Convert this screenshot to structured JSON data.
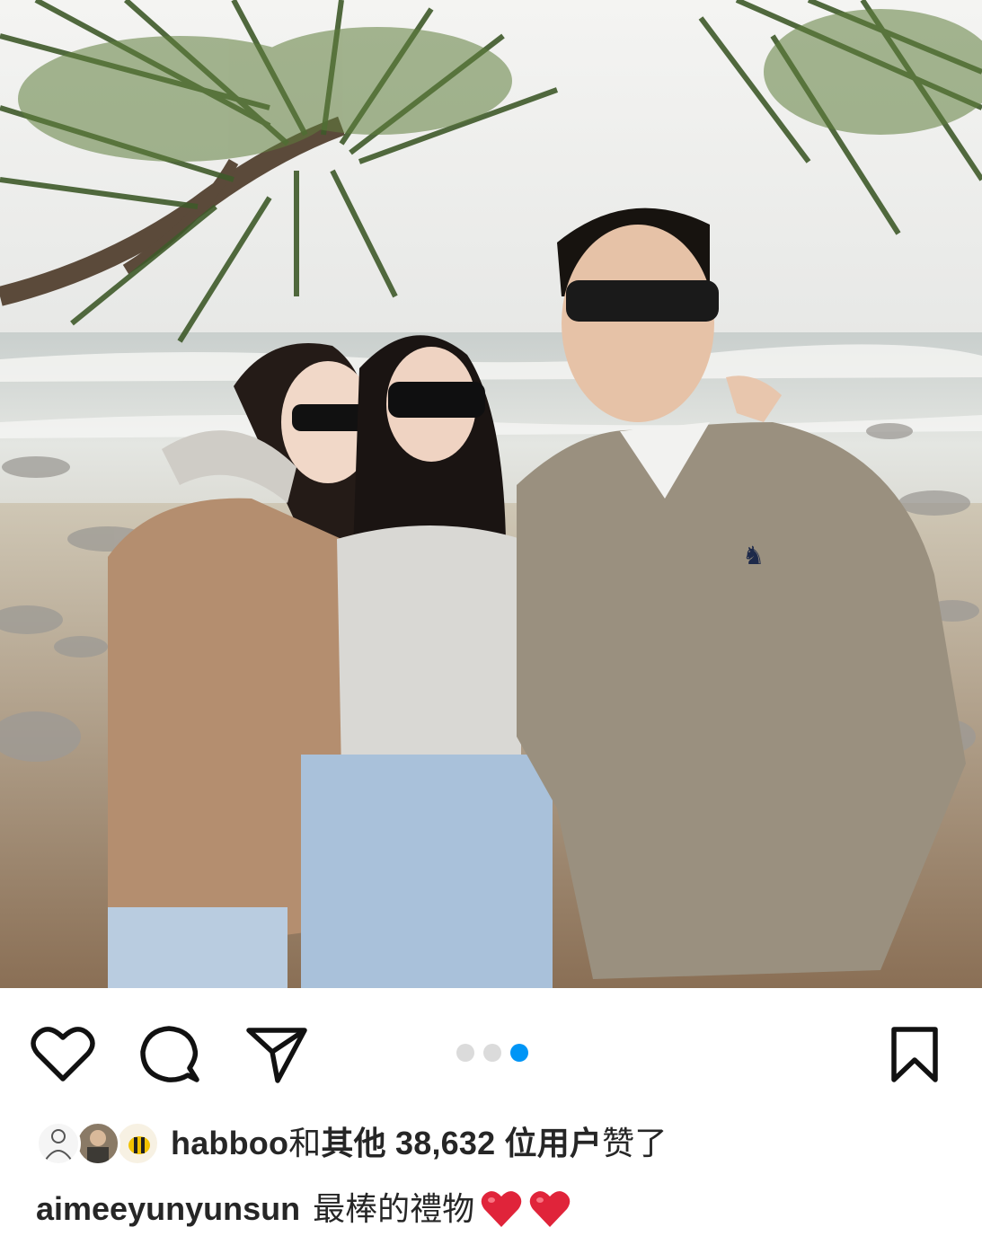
{
  "post": {
    "image_icon": "group-photo-beach",
    "carousel": {
      "total": 3,
      "active_index": 2
    }
  },
  "actions": {
    "like_icon": "heart-outline-icon",
    "comment_icon": "comment-bubble-icon",
    "share_icon": "paper-plane-icon",
    "save_icon": "bookmark-outline-icon"
  },
  "likes": {
    "user": "habboo",
    "connector": "和",
    "others_label": "其他",
    "count": "38,632",
    "suffix_bold": "位用户",
    "suffix": "赞了"
  },
  "caption": {
    "username": "aimeeyunyunsun",
    "text": "最棒的禮物",
    "emoji": "❤️❤️"
  },
  "colors": {
    "accent": "#0095f6",
    "dot_inactive": "#dbdbdb",
    "text": "#262626",
    "heart_emoji": "#e0243a"
  }
}
